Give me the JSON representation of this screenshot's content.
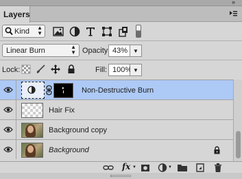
{
  "panel": {
    "tab_title": "Layers",
    "close_glyph": "»"
  },
  "filter": {
    "kind_label": "Kind",
    "icons": [
      "pixel-filter-icon",
      "adjustment-filter-icon",
      "type-filter-icon",
      "shape-filter-icon",
      "smart-object-filter-icon"
    ]
  },
  "blend": {
    "mode": "Linear Burn",
    "opacity_label": "Opacity:",
    "opacity_value": "43%"
  },
  "lock": {
    "label": "Lock:",
    "fill_label": "Fill:",
    "fill_value": "100%"
  },
  "layers": [
    {
      "name": "Non-Destructive Burn",
      "type": "adjustment",
      "selected": true,
      "visible": true,
      "italic": false,
      "locked": false
    },
    {
      "name": "Hair Fix",
      "type": "transparent",
      "selected": false,
      "visible": true,
      "italic": false,
      "locked": false
    },
    {
      "name": "Background copy",
      "type": "photo",
      "selected": false,
      "visible": true,
      "italic": false,
      "locked": false
    },
    {
      "name": "Background",
      "type": "photo",
      "selected": false,
      "visible": true,
      "italic": true,
      "locked": true
    }
  ],
  "bottom_icons": [
    "link-icon",
    "fx-icon",
    "add-mask-icon",
    "adjustment-layer-icon",
    "new-group-icon",
    "new-layer-icon",
    "trash-icon"
  ],
  "fx_label": "fx",
  "colors": {
    "selected_row": "#adc9f5",
    "panel_bg": "#d6d6d6"
  }
}
